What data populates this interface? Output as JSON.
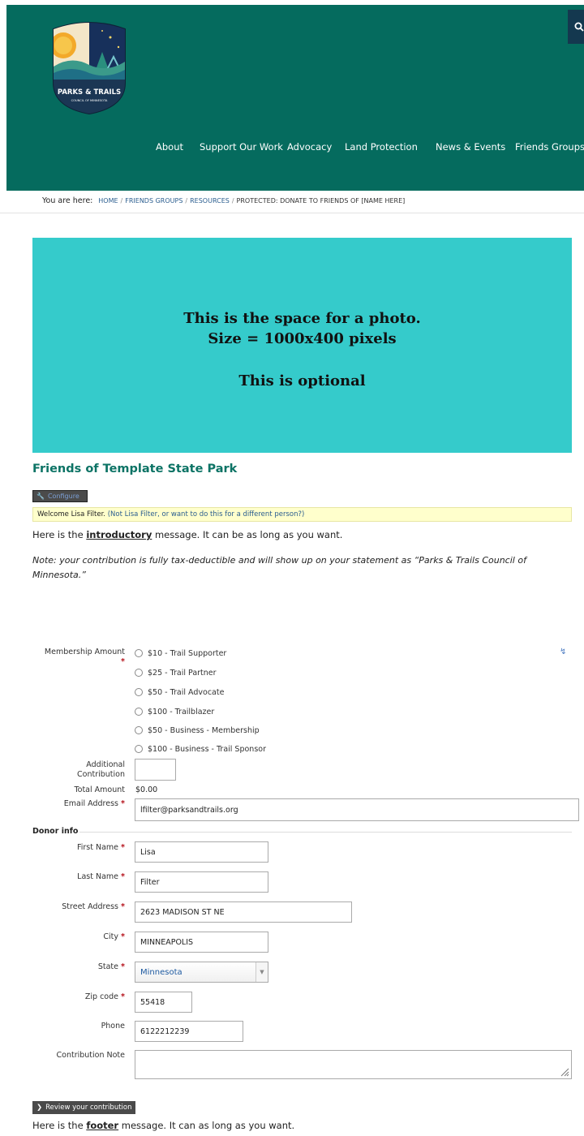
{
  "header": {
    "logo_text": "PARKS & TRAILS",
    "logo_subtext": "COUNCIL OF MINNESOTA",
    "nav": [
      "About",
      "Support Our Work",
      "Advocacy",
      "Land Protection",
      "News & Events",
      "Friends Groups"
    ]
  },
  "breadcrumb": {
    "label": "You are here:",
    "items": [
      "HOME",
      "FRIENDS GROUPS",
      "RESOURCES"
    ],
    "current": "PROTECTED: DONATE TO FRIENDS OF [NAME HERE]"
  },
  "hero": {
    "line1": "This is the space for a photo.",
    "line2": "Size = 1000x400 pixels",
    "line3": "This is optional"
  },
  "page_title": "Friends of Template State Park",
  "configure_label": "Configure",
  "welcome": {
    "text": "Welcome Lisa Filter.",
    "link": "(Not Lisa Filter, or want to do this for a different person?)"
  },
  "intro": {
    "before": "Here is the ",
    "emphasis": "introductory",
    "after": " message. It can be as long as you want."
  },
  "note": "Note: your contribution is fully tax-deductible and will show up on your statement as “Parks & Trails Council of Minnesota.”",
  "form": {
    "membership_label": "Membership Amount",
    "membership_options": [
      "$10 - Trail Supporter",
      "$25 - Trail Partner",
      "$50 - Trail Advocate",
      "$100 - Trailblazer",
      "$50 - Business - Membership",
      "$100 - Business - Trail Sponsor"
    ],
    "additional_label_1": "Additional",
    "additional_label_2": "Contribution",
    "additional_value": "",
    "total_label": "Total Amount",
    "total_value": "$0.00",
    "email_label": "Email Address",
    "email_value": "lfilter@parksandtrails.org",
    "donor_legend": "Donor info",
    "first_name_label": "First Name",
    "first_name_value": "Lisa",
    "last_name_label": "Last Name",
    "last_name_value": "Filter",
    "street_label": "Street Address",
    "street_value": "2623 MADISON ST NE",
    "city_label": "City",
    "city_value": "MINNEAPOLIS",
    "state_label": "State",
    "state_value": "Minnesota",
    "zip_label": "Zip code",
    "zip_value": "55418",
    "phone_label": "Phone",
    "phone_value": "6122212239",
    "note_label": "Contribution Note",
    "required_mark": "*"
  },
  "review_button": "Review your contribution",
  "footer": {
    "before": "Here is the ",
    "emphasis": "footer",
    "after": " message. It can as long as you want."
  },
  "colors": {
    "header_bg": "#056b5e",
    "hero_bg": "#35cbcb",
    "title": "#0c7365",
    "link": "#2a5d8f",
    "required": "#b5121b"
  }
}
